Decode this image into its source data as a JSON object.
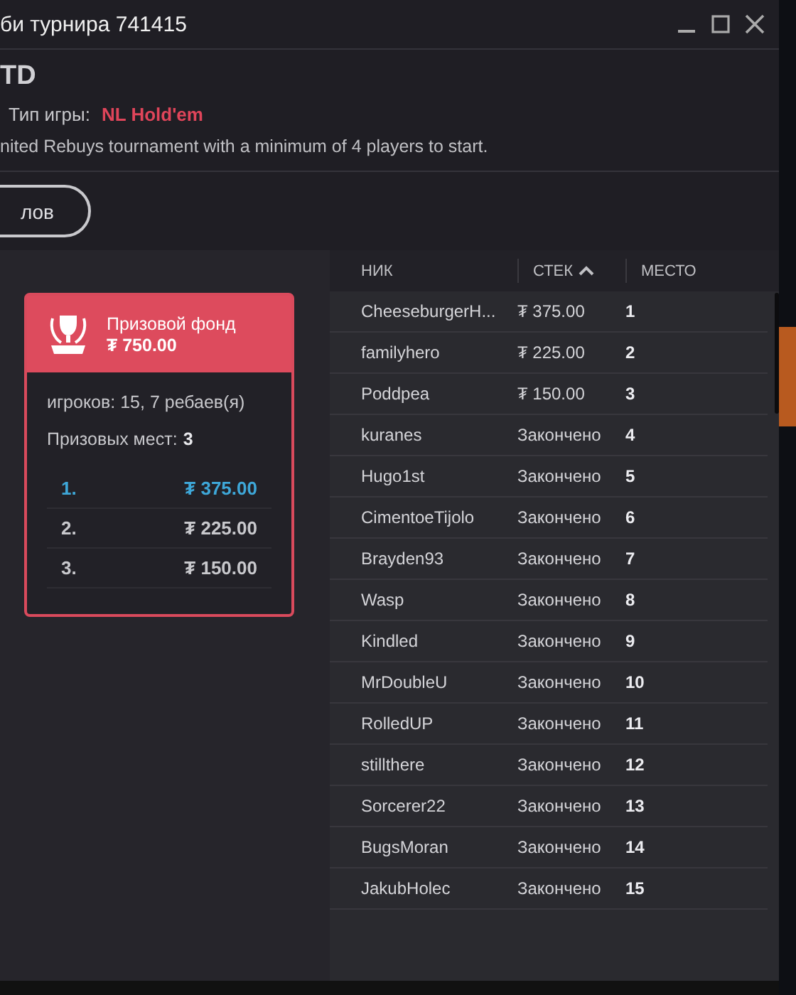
{
  "window": {
    "title": "би турнира 741415"
  },
  "header": {
    "name": "TD",
    "game_type_label": "Тип игры:",
    "game_type": "NL Hold'em",
    "description": "nited Rebuys tournament with a minimum of 4 players to start."
  },
  "button": {
    "label": "лов"
  },
  "prize_card": {
    "title": "Призовой фонд",
    "amount": "₮ 750.00",
    "players": "игроков: 15, 7 ребаев(я)",
    "places_label": "Призовых мест:",
    "places": "3",
    "prizes": [
      {
        "place": "1.",
        "amount": "₮ 375.00",
        "selected": true
      },
      {
        "place": "2.",
        "amount": "₮ 225.00",
        "selected": false
      },
      {
        "place": "3.",
        "amount": "₮ 150.00",
        "selected": false
      }
    ]
  },
  "table": {
    "columns": [
      {
        "label": "НИК",
        "sorted": false
      },
      {
        "label": "СТЕК",
        "sorted": true
      },
      {
        "label": "МЕСТО",
        "sorted": false
      }
    ],
    "rows": [
      [
        "CheeseburgerH...",
        "₮ 375.00",
        "1"
      ],
      [
        "familyhero",
        "₮ 225.00",
        "2"
      ],
      [
        "Poddpea",
        "₮ 150.00",
        "3"
      ],
      [
        "kuranes",
        "Закончено",
        "4"
      ],
      [
        "Hugo1st",
        "Закончено",
        "5"
      ],
      [
        "CimentoeTijolo",
        "Закончено",
        "6"
      ],
      [
        "Brayden93",
        "Закончено",
        "7"
      ],
      [
        "Wasp",
        "Закончено",
        "8"
      ],
      [
        "Kindled",
        "Закончено",
        "9"
      ],
      [
        "MrDoubleU",
        "Закончено",
        "10"
      ],
      [
        "RolledUP",
        "Закончено",
        "11"
      ],
      [
        "stillthere",
        "Закончено",
        "12"
      ],
      [
        "Sorcerer22",
        "Закончено",
        "13"
      ],
      [
        "BugsMoran",
        "Закончено",
        "14"
      ],
      [
        "JakubHolec",
        "Закончено",
        "15"
      ]
    ]
  }
}
